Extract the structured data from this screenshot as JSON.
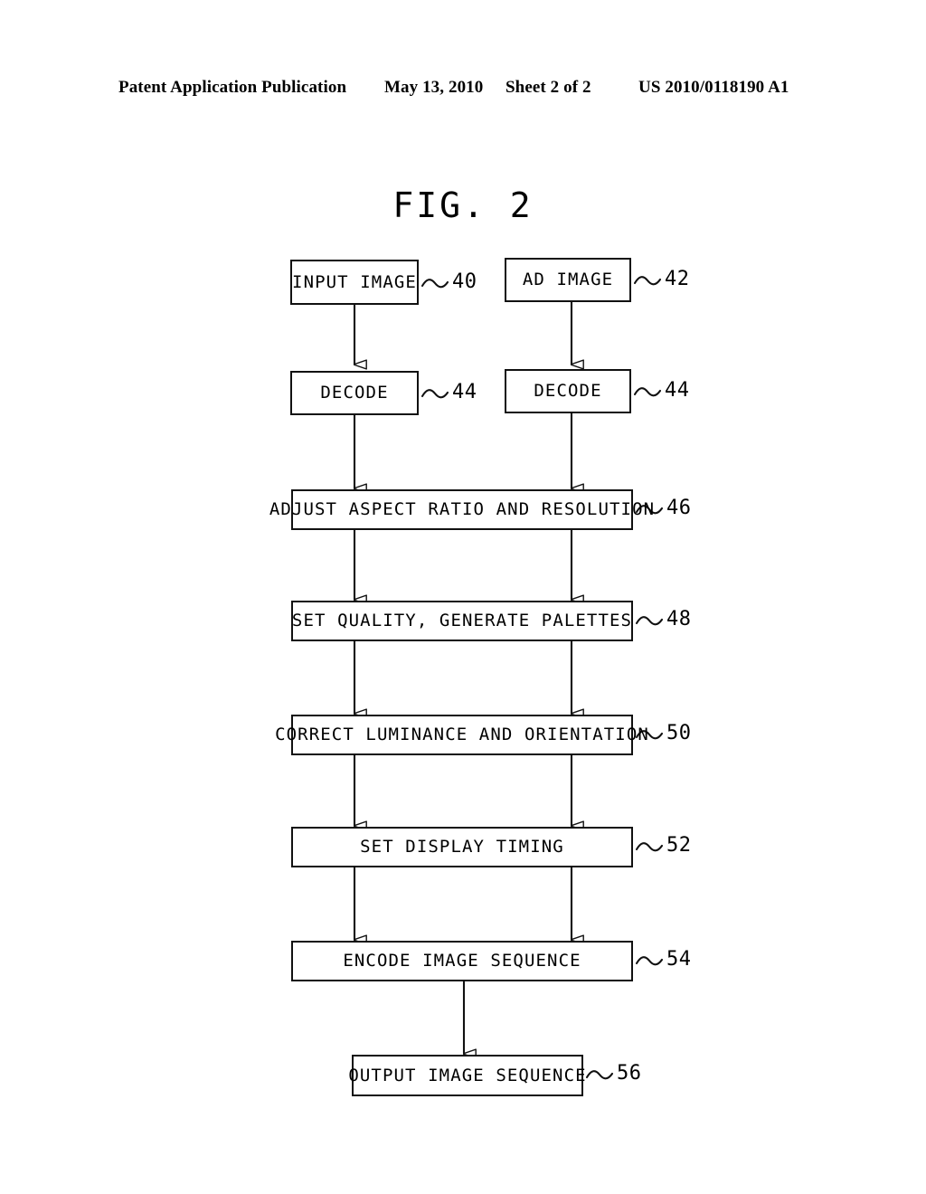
{
  "header": {
    "publication": "Patent Application Publication",
    "date": "May 13, 2010",
    "sheet": "Sheet 2 of 2",
    "patent_number": "US 2010/0118190 A1"
  },
  "figure": {
    "title": "FIG. 2"
  },
  "flowchart": {
    "nodes": [
      {
        "id": "input-image",
        "label": "INPUT IMAGE",
        "ref": "40"
      },
      {
        "id": "ad-image",
        "label": "AD IMAGE",
        "ref": "42"
      },
      {
        "id": "decode-left",
        "label": "DECODE",
        "ref": "44"
      },
      {
        "id": "decode-right",
        "label": "DECODE",
        "ref": "44"
      },
      {
        "id": "adjust-aspect",
        "label": "ADJUST ASPECT RATIO AND RESOLUTION",
        "ref": "46"
      },
      {
        "id": "set-quality",
        "label": "SET QUALITY, GENERATE PALETTES",
        "ref": "48"
      },
      {
        "id": "correct-lum",
        "label": "CORRECT LUMINANCE AND ORIENTATION",
        "ref": "50"
      },
      {
        "id": "set-timing",
        "label": "SET DISPLAY TIMING",
        "ref": "52"
      },
      {
        "id": "encode-seq",
        "label": "ENCODE IMAGE SEQUENCE",
        "ref": "54"
      },
      {
        "id": "output-seq",
        "label": "OUTPUT IMAGE SEQUENCE",
        "ref": "56"
      }
    ],
    "edges": [
      {
        "from": "input-image",
        "to": "decode-left"
      },
      {
        "from": "ad-image",
        "to": "decode-right"
      },
      {
        "from": "decode-left",
        "to": "adjust-aspect"
      },
      {
        "from": "decode-right",
        "to": "adjust-aspect"
      },
      {
        "from": "adjust-aspect",
        "to": "set-quality"
      },
      {
        "from": "set-quality",
        "to": "correct-lum"
      },
      {
        "from": "correct-lum",
        "to": "set-timing"
      },
      {
        "from": "set-timing",
        "to": "encode-seq"
      },
      {
        "from": "encode-seq",
        "to": "output-seq"
      }
    ]
  },
  "colors": {
    "ink": "#111111",
    "paper": "#ffffff"
  }
}
